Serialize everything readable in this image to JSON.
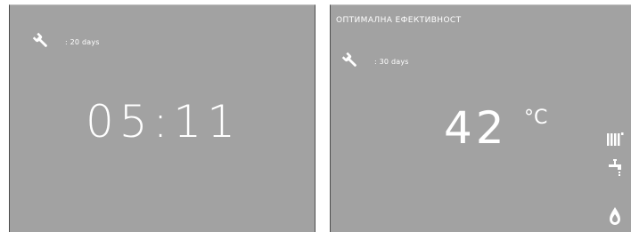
{
  "left_screen": {
    "service_text": ": 20 days",
    "clock": "05:11"
  },
  "right_screen": {
    "mode_title": "ОПТИМАЛНА ЕФЕКТИВНОСТ",
    "service_text": ": 30 days",
    "temperature": "42",
    "temperature_unit": "°C"
  },
  "icons": {
    "service": "wrench-icon",
    "heating": "radiator-icon",
    "hot_water": "tap-icon",
    "flame": "flame-icon"
  },
  "colors": {
    "screen_background": "#a2a2a2",
    "text": "#ffffff"
  }
}
